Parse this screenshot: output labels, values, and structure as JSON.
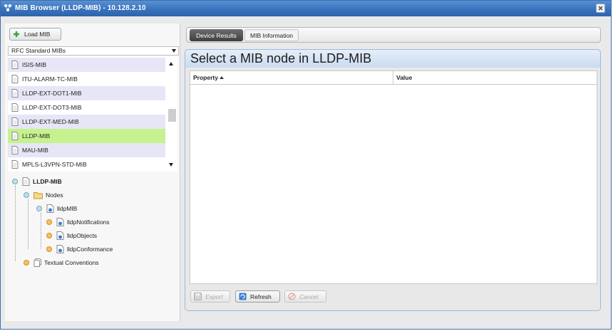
{
  "window": {
    "title": "MIB Browser (LLDP-MIB) - 10.128.2.10"
  },
  "left": {
    "load_button": "Load MIB",
    "mib_source_select": "RFC Standard MIBs",
    "mib_list": [
      {
        "label": "ISIS-MIB",
        "state": "alt"
      },
      {
        "label": "ITU-ALARM-TC-MIB",
        "state": "plain"
      },
      {
        "label": "LLDP-EXT-DOT1-MIB",
        "state": "alt"
      },
      {
        "label": "LLDP-EXT-DOT3-MIB",
        "state": "plain"
      },
      {
        "label": "LLDP-EXT-MED-MIB",
        "state": "alt"
      },
      {
        "label": "LLDP-MIB",
        "state": "selected"
      },
      {
        "label": "MAU-MIB",
        "state": "alt"
      },
      {
        "label": "MPLS-L3VPN-STD-MIB",
        "state": "plain"
      }
    ],
    "tree": {
      "root": "LLDP-MIB",
      "nodes": "Nodes",
      "lldp_mib": "lldpMIB",
      "children": [
        "lldpNotifications",
        "lldpObjects",
        "lldpConformance"
      ],
      "textual_conventions": "Textual Conventions"
    }
  },
  "tabs": [
    "Device Results",
    "MIB Information"
  ],
  "panel": {
    "heading": "Select a MIB node in LLDP-MIB",
    "columns": [
      "Property",
      "Value"
    ]
  },
  "buttons": {
    "export": "Export",
    "refresh": "Refresh",
    "cancel": "Cancel"
  },
  "colors": {
    "titlebar": "#3873bd",
    "selected_row": "#c5f28e",
    "alt_row": "#e6e6f7"
  }
}
